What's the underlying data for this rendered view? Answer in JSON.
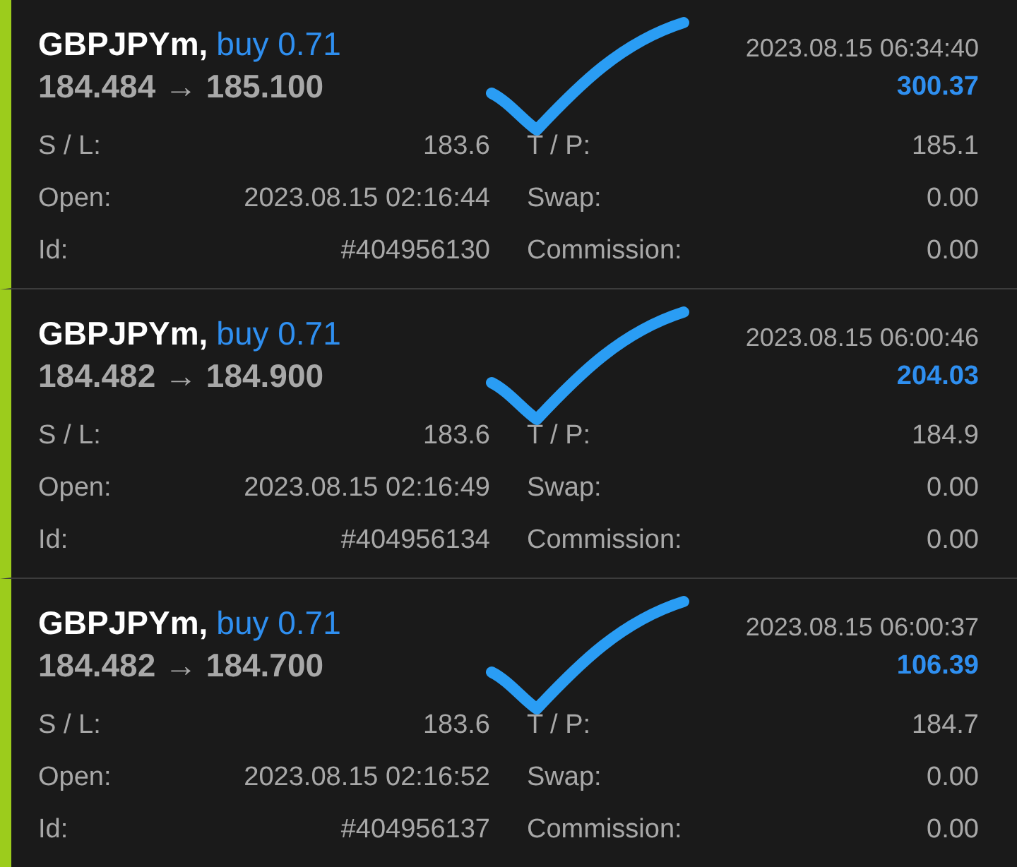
{
  "trades": [
    {
      "symbol": "GBPJPYm,",
      "side": "buy 0.71",
      "prices": "184.484 → 185.100",
      "time": "2023.08.15 06:34:40",
      "profit": "300.37",
      "checked": true,
      "fields": [
        {
          "label": "S / L:",
          "value": "183.6"
        },
        {
          "label": "T / P:",
          "value": "185.1"
        },
        {
          "label": "Open:",
          "value": "2023.08.15 02:16:44"
        },
        {
          "label": "Swap:",
          "value": "0.00"
        },
        {
          "label": "Id:",
          "value": "#404956130"
        },
        {
          "label": "Commission:",
          "value": "0.00"
        }
      ]
    },
    {
      "symbol": "GBPJPYm,",
      "side": "buy 0.71",
      "prices": "184.482 → 184.900",
      "time": "2023.08.15 06:00:46",
      "profit": "204.03",
      "checked": true,
      "fields": [
        {
          "label": "S / L:",
          "value": "183.6"
        },
        {
          "label": "T / P:",
          "value": "184.9"
        },
        {
          "label": "Open:",
          "value": "2023.08.15 02:16:49"
        },
        {
          "label": "Swap:",
          "value": "0.00"
        },
        {
          "label": "Id:",
          "value": "#404956134"
        },
        {
          "label": "Commission:",
          "value": "0.00"
        }
      ]
    },
    {
      "symbol": "GBPJPYm,",
      "side": "buy 0.71",
      "prices": "184.482 → 184.700",
      "time": "2023.08.15 06:00:37",
      "profit": "106.39",
      "checked": true,
      "fields": [
        {
          "label": "S / L:",
          "value": "183.6"
        },
        {
          "label": "T / P:",
          "value": "184.7"
        },
        {
          "label": "Open:",
          "value": "2023.08.15 02:16:52"
        },
        {
          "label": "Swap:",
          "value": "0.00"
        },
        {
          "label": "Id:",
          "value": "#404956137"
        },
        {
          "label": "Commission:",
          "value": "0.00"
        }
      ]
    }
  ]
}
